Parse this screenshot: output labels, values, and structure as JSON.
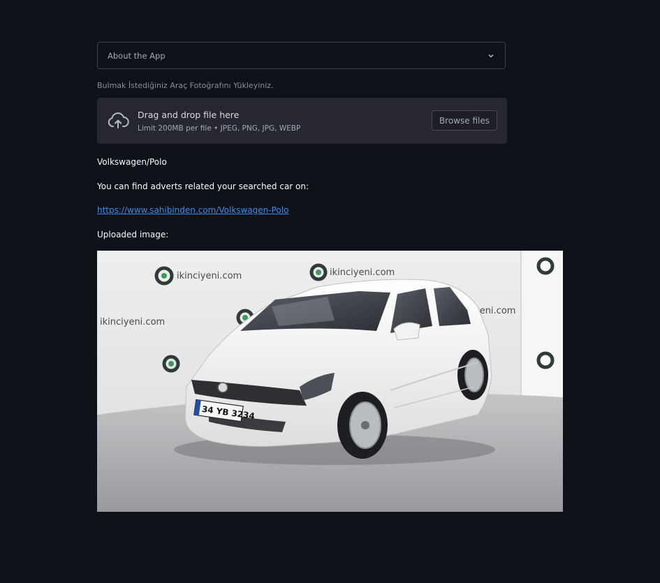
{
  "expander": {
    "label": "About the App",
    "icon": "chevron-down-icon"
  },
  "uploader": {
    "label": "Bulmak İstediğiniz Araç Fotoğrafını Yükleyiniz.",
    "drop_title": "Drag and drop file here",
    "limit_text": "Limit 200MB per file • JPEG, PNG, JPG, WEBP",
    "browse_label": "Browse files",
    "icon": "cloud-upload-icon"
  },
  "result": {
    "car_name": "Volkswagen/Polo",
    "adverts_text": "You can find adverts related your searched car on:",
    "link": "https://www.sahibinden.com/Volkswagen-Polo",
    "image_caption": "Uploaded image:"
  },
  "photo": {
    "watermark": "ikinciyeni.com",
    "plate": "34 YB 3234"
  }
}
